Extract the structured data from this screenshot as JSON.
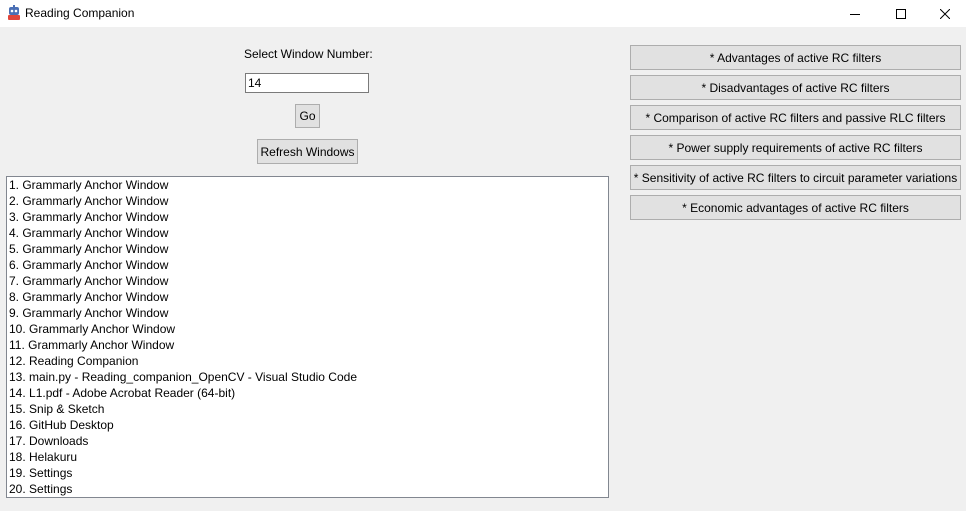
{
  "window": {
    "title": "Reading Companion",
    "app_icon": "robot-app-icon",
    "controls": {
      "minimize_icon": "minimize-icon",
      "maximize_icon": "maximize-icon",
      "close_icon": "close-icon"
    }
  },
  "selector": {
    "label": "Select Window Number:",
    "input_value": "14",
    "go_label": "Go",
    "refresh_label": "Refresh Windows"
  },
  "window_list": [
    "1. Grammarly Anchor Window",
    "2. Grammarly Anchor Window",
    "3. Grammarly Anchor Window",
    "4. Grammarly Anchor Window",
    "5. Grammarly Anchor Window",
    "6. Grammarly Anchor Window",
    "7. Grammarly Anchor Window",
    "8. Grammarly Anchor Window",
    "9. Grammarly Anchor Window",
    "10. Grammarly Anchor Window",
    "11. Grammarly Anchor Window",
    "12. Reading Companion",
    "13. main.py - Reading_companion_OpenCV - Visual Studio Code",
    "14. L1.pdf - Adobe Acrobat Reader (64-bit)",
    "15. Snip & Sketch",
    "16. GitHub Desktop",
    "17. Downloads",
    "18. Helakuru",
    "19. Settings",
    "20. Settings"
  ],
  "topics": [
    "* Advantages of active RC filters",
    "* Disadvantages of active RC filters",
    "* Comparison of active RC filters and passive RLC filters",
    "* Power supply requirements of active RC filters",
    "* Sensitivity of active RC filters to circuit parameter variations",
    "* Economic advantages of active RC filters"
  ]
}
